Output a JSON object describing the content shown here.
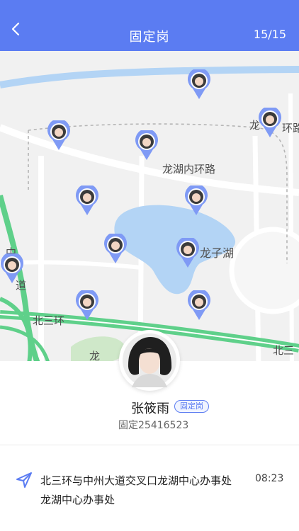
{
  "header": {
    "title": "固定岗",
    "counter": "15/15",
    "back_icon": "chevron-left-icon"
  },
  "map": {
    "labels": {
      "road_inner": "龙湖内环路",
      "lake": "龙子湖",
      "ring_left": "北三环",
      "ring_right": "北三",
      "road_top_right": "龙",
      "road_top_right2": "环路",
      "road_vertical1": "中",
      "road_vertical2": "道",
      "road_bottom": "龙"
    }
  },
  "person": {
    "name": "张筱雨",
    "tag": "固定岗",
    "phone": "固定25416523"
  },
  "location": {
    "icon": "navigation-arrow-icon",
    "address": "北三环与中州大道交叉口龙湖中心办事处龙湖中心办事处",
    "time": "08:23"
  },
  "colors": {
    "primary": "#5b7cf2",
    "water": "#b3d4f5",
    "ring_road": "#5fd08a"
  }
}
